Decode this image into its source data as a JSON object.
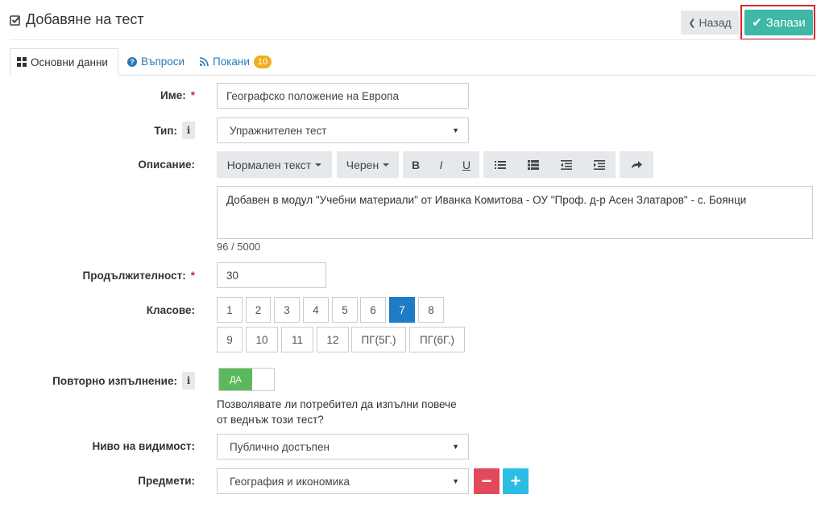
{
  "header": {
    "title": "Добавяне на тест",
    "back_label": "Назад",
    "save_label": "Запази"
  },
  "tabs": [
    {
      "label": "Основни данни",
      "icon": "grid-icon"
    },
    {
      "label": "Въпроси",
      "icon": "question-circle-icon"
    },
    {
      "label": "Покани",
      "icon": "rss-icon",
      "badge": "10"
    }
  ],
  "form": {
    "name": {
      "label": "Име:",
      "required_mark": "*",
      "value": "Географско положение на Европа"
    },
    "type": {
      "label": "Тип:",
      "info": "i",
      "value": "Упражнителен тест"
    },
    "description": {
      "label": "Описание:",
      "toolbar": {
        "format": "Нормален текст",
        "color": "Черен",
        "bold": "B",
        "italic": "I",
        "underline": "U"
      },
      "value": "Добавен в модул \"Учебни материали\" от Иванка Комитова - ОУ \"Проф. д-р Асен Златаров\" - с. Боянци",
      "counter": "96 / 5000"
    },
    "duration": {
      "label": "Продължителност:",
      "required_mark": "*",
      "value": "30"
    },
    "grades": {
      "label": "Класове:",
      "row1": [
        "1",
        "2",
        "3",
        "4",
        "5",
        "6",
        "7",
        "8"
      ],
      "row2": [
        "9",
        "10",
        "11",
        "12",
        "ПГ(5Г.)",
        "ПГ(6Г.)"
      ],
      "selected": "7"
    },
    "repeat": {
      "label": "Повторно изпълнение:",
      "info": "i",
      "toggle_label": "ДА",
      "help_line1": "Позволявате ли потребител да изпълни повече",
      "help_line2": "от веднъж този тест?"
    },
    "visibility": {
      "label": "Ниво на видимост:",
      "value": "Публично достъпен"
    },
    "subjects": {
      "label": "Предмети:",
      "value": "География и икономика",
      "remove": "−",
      "add": "+"
    }
  },
  "colors": {
    "save": "#3fb8a8",
    "selected_grade": "#1e7bc5",
    "toggle_on": "#5cb85c",
    "remove": "#e24a5c",
    "add": "#2bbde3",
    "highlight": "#d9262c"
  }
}
